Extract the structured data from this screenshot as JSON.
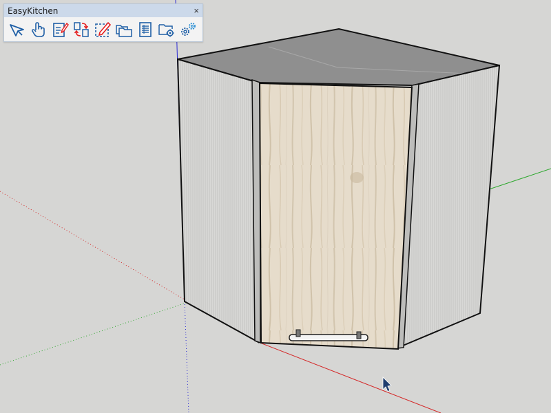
{
  "toolbar": {
    "title": "EasyKitchen",
    "close_glyph": "×",
    "buttons": [
      {
        "name": "select-arrow-icon"
      },
      {
        "name": "pan-hand-icon"
      },
      {
        "name": "edit-document-icon"
      },
      {
        "name": "swap-cabinets-icon"
      },
      {
        "name": "edit-selection-icon"
      },
      {
        "name": "folders-icon"
      },
      {
        "name": "cut-list-report-icon"
      },
      {
        "name": "folder-settings-icon"
      },
      {
        "name": "settings-gears-icon"
      }
    ]
  },
  "colors": {
    "background": "#d6d6d4",
    "titlebar": "#ccd9ea",
    "icon_blue": "#1f5fa6",
    "icon_red": "#e52020",
    "axis_red": "#d42a2a",
    "axis_green": "#2ea82e",
    "axis_blue": "#2a2ad4"
  }
}
